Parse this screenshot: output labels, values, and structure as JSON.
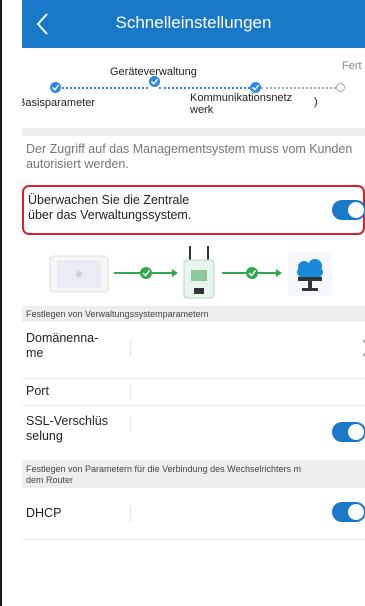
{
  "header": {
    "title": "Schnelleinstellungen",
    "back_icon": "chevron-left-icon"
  },
  "stepper": {
    "steps": [
      {
        "label": "Basisparameter",
        "state": "done"
      },
      {
        "label": "Geräteverwaltung",
        "state": "done"
      },
      {
        "label": "Kommunikationsnetz werk",
        "label_line1": "Kommunikationsnetz",
        "label_line2": "werk",
        "state": "done"
      },
      {
        "label": "Fert",
        "state": "pending"
      }
    ],
    "trailing_fragment": ")"
  },
  "info_text": "Der Zugriff auf das Managementsystem muss vom Kunden autorisiert werden.",
  "monitor_toggle": {
    "label_line1": "Überwachen Sie die Zentrale",
    "label_line2": "über das Verwaltungssystem.",
    "on": true
  },
  "diagram": {
    "icons": [
      "inverter-icon",
      "check-icon",
      "router-icon",
      "check-icon",
      "cloud-server-icon"
    ]
  },
  "mgmt_section": {
    "header": "Festlegen von Verwaltungssystemparametern",
    "fields": [
      {
        "label_line1": "Domänenna-",
        "label_line2": "me",
        "value": "",
        "has_chevron": true
      },
      {
        "label": "Port",
        "value": ""
      },
      {
        "label_line1": "SSL-Verschlüs",
        "label_line2": "selung",
        "toggle_on": true
      }
    ]
  },
  "router_section": {
    "header_line1": "Festlegen von Parametern für die Verbindung des Wechselrichters m",
    "header_line2": "dem Router",
    "fields": [
      {
        "label": "DHCP",
        "toggle_on": true
      }
    ]
  },
  "colors": {
    "accent": "#1a78c8",
    "highlight_border": "#d2252a",
    "check_green": "#2fa84f",
    "section_bg": "#eeeeee"
  }
}
